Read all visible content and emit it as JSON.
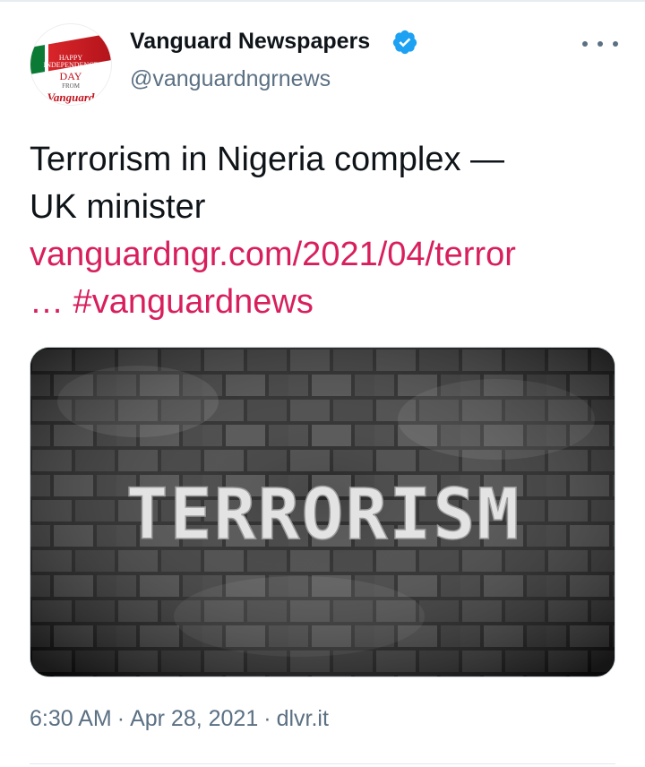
{
  "author": {
    "display_name": "Vanguard Newspapers",
    "handle": "@vanguardngrnews",
    "verified": true,
    "avatar": {
      "line1": "HAPPY",
      "line2": "INDEPENDENCE",
      "line3": "DAY",
      "line4": "FROM",
      "brand": "Vanguard"
    }
  },
  "tweet": {
    "text_line1": "Terrorism in Nigeria complex —",
    "text_line2": "UK minister",
    "link_line1": "vanguardngr.com/2021/04/terror",
    "link_line2": "… #vanguardnews",
    "media_text": "TERRORISM"
  },
  "meta": {
    "time": "6:30 AM",
    "date": "Apr 28, 2021",
    "source": "dlvr.it",
    "separator": "·"
  },
  "colors": {
    "link": "#d81f5c",
    "secondary_text": "#5b7083",
    "verified_badge": "#1da1f2"
  },
  "icons": {
    "verified": "verified-badge-icon",
    "more": "more-dots-icon"
  }
}
